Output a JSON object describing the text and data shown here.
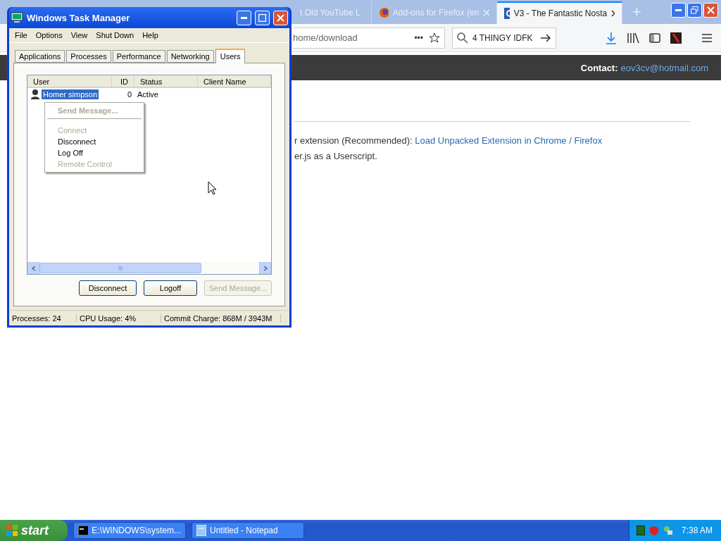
{
  "browser": {
    "tabs": [
      {
        "title": "t Old YouTube L",
        "kind": "plain",
        "selected": false
      },
      {
        "title": "Add-ons for Firefox (en",
        "kind": "firefox",
        "selected": false
      },
      {
        "title": "V3 - The Fantastic Nosta",
        "kind": "google",
        "selected": true
      }
    ],
    "new_tab": "+",
    "address": "home/download",
    "address_more": "•••",
    "search": "4 THINGY IDFK",
    "header": {
      "label": "Contact:",
      "email": "eov3cv@hotmail.com"
    },
    "content": {
      "line_1": "r extension (Recommended): ",
      "link": "Load Unpacked Extension in Chrome / Firefox",
      "line_2": "er.js as a Userscript."
    }
  },
  "task_manager": {
    "title": "Windows Task Manager",
    "menu": [
      "File",
      "Options",
      "View",
      "Shut Down",
      "Help"
    ],
    "tabs": [
      {
        "label": "Applications",
        "selected": false
      },
      {
        "label": "Processes",
        "selected": false
      },
      {
        "label": "Performance",
        "selected": false
      },
      {
        "label": "Networking",
        "selected": false
      },
      {
        "label": "Users",
        "selected": true
      }
    ],
    "columns": [
      "User",
      "ID",
      "Status",
      "Client Name"
    ],
    "rows": [
      {
        "user": "Homer simpson",
        "id": "0",
        "status": "Active",
        "selected": true
      }
    ],
    "context_menu": [
      {
        "label": "Send Message...",
        "disabled": true,
        "default": true,
        "separator_after": true
      },
      {
        "label": "Connect",
        "disabled": true,
        "default": false,
        "separator_after": false
      },
      {
        "label": "Disconnect",
        "disabled": false,
        "default": false,
        "separator_after": false
      },
      {
        "label": "Log Off",
        "disabled": false,
        "default": false,
        "separator_after": false
      },
      {
        "label": "Remote Control",
        "disabled": true,
        "default": false,
        "separator_after": false
      }
    ],
    "buttons": [
      {
        "label": "Disconnect",
        "disabled": false
      },
      {
        "label": "Logoff",
        "disabled": false
      },
      {
        "label": "Send Message...",
        "disabled": true
      }
    ],
    "status_bar": [
      "Processes: 24",
      "CPU Usage: 4%",
      "Commit Charge: 868M / 3943M"
    ]
  },
  "taskbar": {
    "start": "start",
    "tasks": [
      {
        "label": "E:\\WINDOWS\\system...",
        "kind": "console"
      },
      {
        "label": "Untitled - Notepad",
        "kind": "notepad"
      }
    ],
    "clock": "7:38 AM"
  }
}
